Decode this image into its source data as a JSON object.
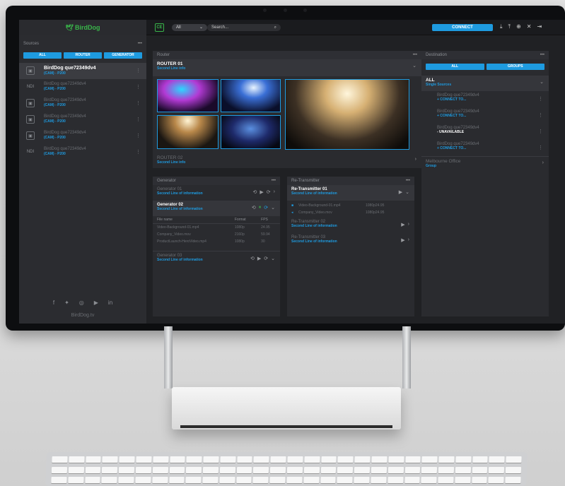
{
  "brand": {
    "logo": "BirdDog",
    "site": "BirdDog.tv",
    "ce": "CE",
    "accent": "#1e9be0",
    "brand_green": "#39b54a"
  },
  "topbar": {
    "filter_value": "All",
    "search_placeholder": "Search...",
    "connect_label": "CONNECT"
  },
  "sources": {
    "title": "Sources",
    "tabs": [
      "ALL",
      "ROUTER",
      "GENERATOR"
    ],
    "items": [
      {
        "name": "BirdDog que72349dv4",
        "sub": "(CAM) - P200",
        "icon": "camera-icon",
        "active": true
      },
      {
        "name": "BirdDog que72349dv4",
        "sub": "(CAM) - P200",
        "icon": "ndi-icon"
      },
      {
        "name": "BirdDog que72349dv4",
        "sub": "(CAM) - P200",
        "icon": "camera-icon"
      },
      {
        "name": "BirdDog que72349dv4",
        "sub": "(CAM) - P200",
        "icon": "camera-icon"
      },
      {
        "name": "BirdDog que72349dv4",
        "sub": "(CAM) - P200",
        "icon": "camera-icon"
      },
      {
        "name": "BirdDog que72349dv4",
        "sub": "(CAM) - P200",
        "icon": "ndi-icon"
      }
    ],
    "ndi_label": "NDI"
  },
  "router": {
    "title": "Router",
    "r1": {
      "title": "ROUTER 01",
      "sub": "Second Line info"
    },
    "r2": {
      "title": "ROUTER 02",
      "sub": "Second Line info"
    }
  },
  "generator": {
    "title": "Generator",
    "g1": {
      "title": "Generator 01",
      "sub": "Second Line of information"
    },
    "g2": {
      "title": "Generator 02",
      "sub": "Second Line of information"
    },
    "g3": {
      "title": "Generator 03",
      "sub": "Second Line of information"
    },
    "table": {
      "headers": [
        "File name",
        "Format",
        "FPS"
      ],
      "rows": [
        [
          "Video-Background-01.mp4",
          "1080p",
          "24.95"
        ],
        [
          "Company_Video.mov",
          "2160p",
          "59.94"
        ],
        [
          "ProductLaunch-HeroVideo.mp4",
          "1080p",
          "30"
        ]
      ]
    }
  },
  "retransmitter": {
    "title": "Re-Transmitter",
    "t1": {
      "title": "Re-Transmitter 01",
      "sub": "Second Line of information"
    },
    "t1_files": [
      {
        "name": "Video-Background-01.mp4",
        "fmt": "1080p24.95"
      },
      {
        "name": "Company_Video.mov",
        "fmt": "1080p24.95"
      }
    ],
    "t2": {
      "title": "Re-Transmitter 02",
      "sub": "Second Line of information"
    },
    "t3": {
      "title": "Re-Transmitter 03",
      "sub": "Second Line of information"
    }
  },
  "destination": {
    "title": "Destination",
    "tabs": [
      "ALL",
      "GROUPS"
    ],
    "group_all": {
      "title": "ALL",
      "sub": "Single Sources"
    },
    "items": [
      {
        "name": "BirdDog que72349dv4",
        "action": "+ CONNECT TO..."
      },
      {
        "name": "BirdDog que72349dv4",
        "action": "+ CONNECT TO..."
      },
      {
        "name": "BirdDog que72349dv4",
        "action": "- UNAVAILABLE"
      },
      {
        "name": "BirdDog que72349dv4",
        "action": "+ CONNECT TO..."
      }
    ],
    "group2": {
      "title": "Melbourne Office",
      "sub": "Group"
    }
  }
}
